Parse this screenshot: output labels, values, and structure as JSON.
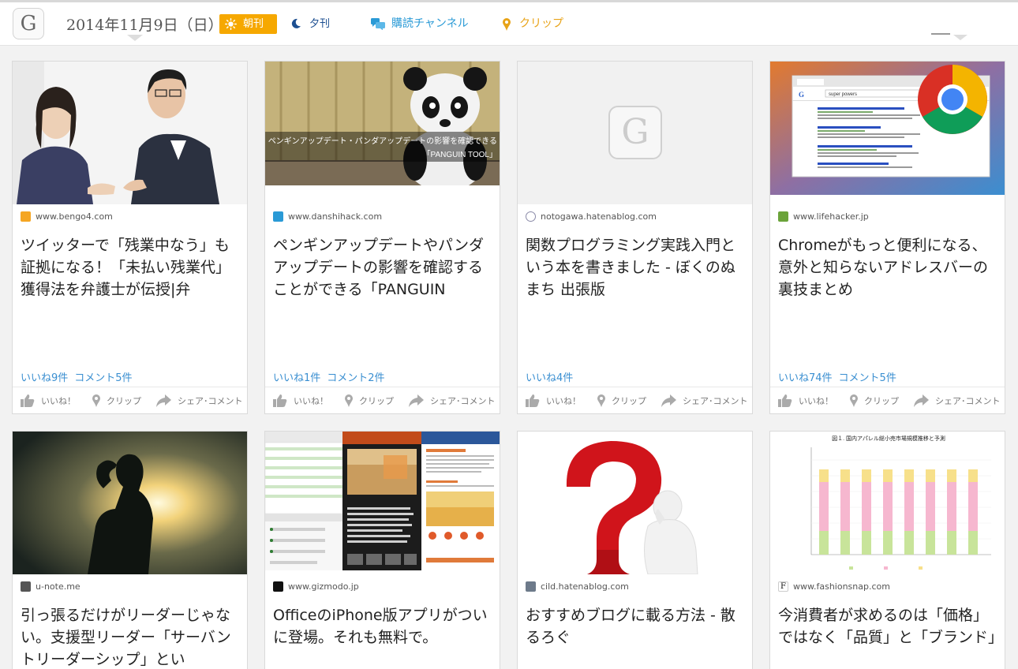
{
  "header": {
    "logo_letter": "G",
    "date": "2014年11月9日（日）",
    "tab_morning": "朝刊",
    "tab_evening": "夕刊",
    "nav_channel": "購読チャンネル",
    "nav_clip": "クリップ"
  },
  "actions": {
    "like": "いいね！",
    "clip": "クリップ",
    "share": "シェア･コメント"
  },
  "cards": [
    {
      "domain": "www.bengo4.com",
      "title": "ツイッターで「残業中なう」も証拠になる！「未払い残業代」獲得法を弁護士が伝授|弁",
      "likes": "いいね9件",
      "comments": "コメント5件",
      "favicon_color": "#f5a623"
    },
    {
      "domain": "www.danshihack.com",
      "title": "ペンギンアップデートやパンダアップデートの影響を確認することができる「PANGUIN",
      "likes": "いいね1件",
      "comments": "コメント2件",
      "image_caption_1": "ペンギンアップデート・パンダアップデートの影響を確認できる",
      "image_caption_2": "「PANGUIN TOOL」",
      "favicon_color": "#2a9ad6"
    },
    {
      "domain": "notogawa.hatenablog.com",
      "title": "関数プログラミング実践入門という本を書きました - ぼくのぬまち 出張版",
      "likes": "いいね4件",
      "comments": "",
      "placeholder_letter": "G",
      "favicon_color": "#8a8aa8"
    },
    {
      "domain": "www.lifehacker.jp",
      "title": "Chromeがもっと便利になる、意外と知らないアドレスバーの裏技まとめ",
      "likes": "いいね74件",
      "comments": "コメント5件",
      "favicon_color": "#6ba33a",
      "browser_search_text": "super powers"
    },
    {
      "domain": "u-note.me",
      "title": "引っ張るだけがリーダーじゃない。支援型リーダー「サーバントリーダーシップ」とい",
      "favicon_color": "#555555"
    },
    {
      "domain": "www.gizmodo.jp",
      "title": "OfficeのiPhone版アプリがついに登場。それも無料で。",
      "favicon_color": "#111111"
    },
    {
      "domain": "cild.hatenablog.com",
      "title": "おすすめブログに載る方法 - 散るろぐ",
      "favicon_color": "#6d7a8a"
    },
    {
      "domain": "www.fashionsnap.com",
      "title": "今消費者が求めるのは「価格」ではなく「品質」と「ブランド」",
      "favicon_color": "#ffffff",
      "chart_title": "図１. 国内アパレル総小売市場規模推移と予測"
    }
  ]
}
